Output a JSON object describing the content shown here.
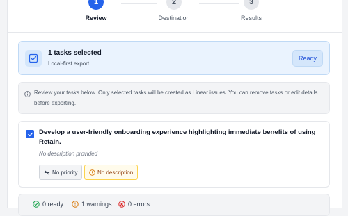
{
  "stepper": {
    "steps": [
      {
        "number": "1",
        "label": "Review",
        "active": true
      },
      {
        "number": "2",
        "label": "Destination",
        "active": false
      },
      {
        "number": "3",
        "label": "Results",
        "active": false
      }
    ]
  },
  "summary": {
    "title": "1 tasks selected",
    "subtitle": "Local-first export",
    "badge": "Ready"
  },
  "info": {
    "text": "Review your tasks below. Only selected tasks will be created as Linear issues. You can remove tasks or edit details before exporting."
  },
  "task": {
    "checked": true,
    "title": "Develop a user-friendly onboarding experience highlighting immediate benefits of using Retain.",
    "description": "No description provided",
    "priority_chip": "No priority",
    "description_chip": "No description"
  },
  "footer": {
    "ready": "0 ready",
    "warnings": "1 warnings",
    "errors": "0 errors"
  },
  "colors": {
    "accent": "#2563eb",
    "success": "#16a34a",
    "warning": "#d97706",
    "error": "#dc2626"
  }
}
